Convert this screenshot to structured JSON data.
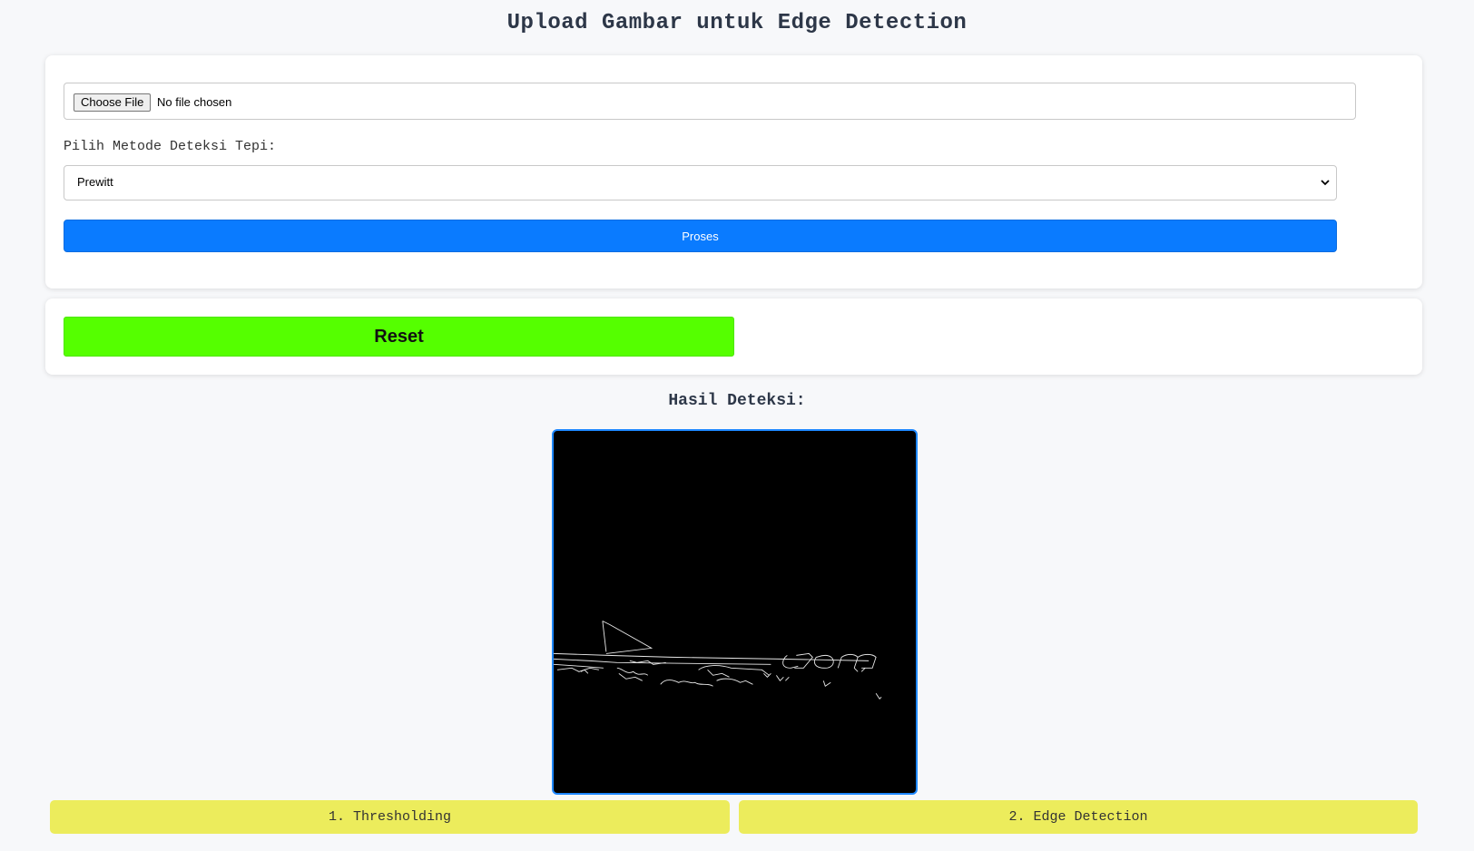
{
  "header": {
    "title": "Upload Gambar untuk Edge Detection"
  },
  "upload": {
    "choose_label": "Choose File",
    "file_status": "No file chosen",
    "method_label": "Pilih Metode Deteksi Tepi:",
    "method_selected": "Prewitt",
    "submit_label": "Proses"
  },
  "reset": {
    "label": "Reset"
  },
  "result": {
    "heading": "Hasil Deteksi:"
  },
  "steps": [
    {
      "label": "1. Thresholding"
    },
    {
      "label": "2. Edge Detection"
    }
  ],
  "colors": {
    "primary": "#0a7bff",
    "reset": "#55ff00",
    "step": "#ecec5c",
    "frame": "#1e88ff"
  }
}
